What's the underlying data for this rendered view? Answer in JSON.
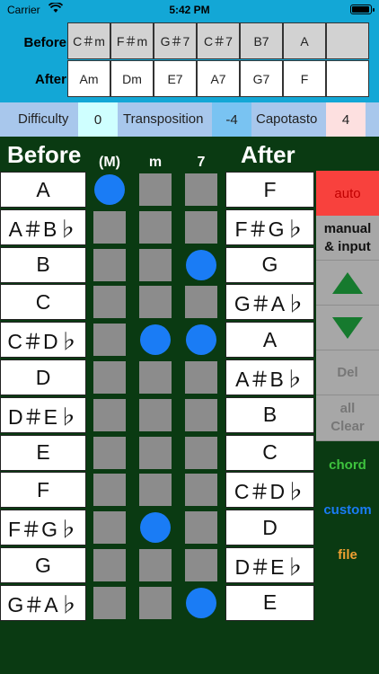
{
  "status": {
    "carrier": "Carrier",
    "time": "5:42 PM"
  },
  "chart_row": {
    "before_label": "Before",
    "after_label": "After",
    "before": [
      "C＃m",
      "F＃m",
      "G＃7",
      "C＃7",
      "B7",
      "A",
      ""
    ],
    "after": [
      "Am",
      "Dm",
      "E7",
      "A7",
      "G7",
      "F",
      ""
    ]
  },
  "params": {
    "difficulty_label": "Difficulty",
    "difficulty_value": "0",
    "transposition_label": "Transposition",
    "transposition_value": "-4",
    "capotasto_label": "Capotasto",
    "capotasto_value": "4"
  },
  "grid": {
    "before_header": "Before",
    "col_major": "(M)",
    "col_minor": "m",
    "col_seventh": "7",
    "after_header": "After",
    "before_notes": [
      "A",
      "A＃B♭",
      "B",
      "C",
      "C＃D♭",
      "D",
      "D＃E♭",
      "E",
      "F",
      "F＃G♭",
      "G",
      "G＃A♭"
    ],
    "after_notes": [
      "F",
      "F＃G♭",
      "G",
      "G＃A♭",
      "A",
      "A＃B♭",
      "B",
      "C",
      "C＃D♭",
      "D",
      "D＃E♭",
      "E"
    ],
    "major_selected": [
      true,
      false,
      false,
      false,
      false,
      false,
      false,
      false,
      false,
      false,
      false,
      false
    ],
    "minor_selected": [
      false,
      false,
      false,
      false,
      true,
      false,
      false,
      false,
      false,
      true,
      false,
      false
    ],
    "seventh_selected": [
      false,
      false,
      true,
      false,
      true,
      false,
      false,
      false,
      false,
      false,
      false,
      true
    ]
  },
  "side": {
    "auto": "auto",
    "manual": "manual\n& input",
    "del": "Del",
    "all_clear": "all\nClear",
    "chord": "chord",
    "custom": "custom",
    "file": "file"
  },
  "colors": {
    "auto_bg": "#f8413d",
    "dot": "#1a7cf5",
    "chord": "#3ec33e",
    "custom": "#1a7cf5",
    "file": "#f0a032"
  }
}
